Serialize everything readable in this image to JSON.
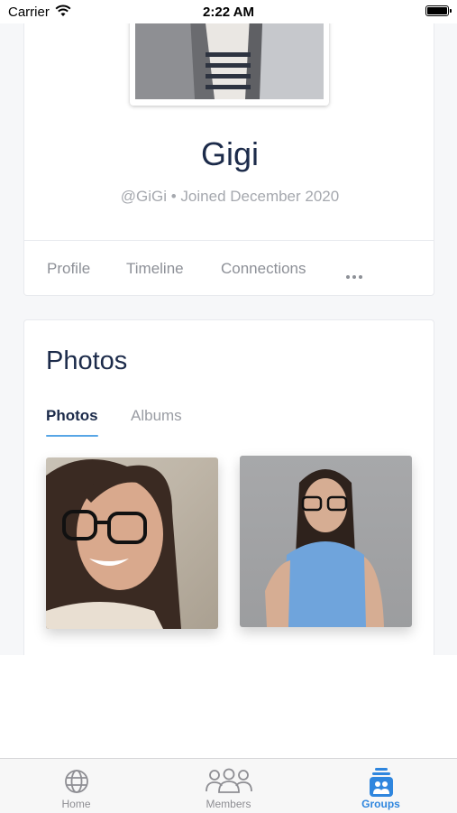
{
  "status_bar": {
    "carrier": "Carrier",
    "time": "2:22 AM"
  },
  "profile": {
    "name": "Gigi",
    "meta": "@GiGi • Joined December 2020",
    "tabs": [
      "Profile",
      "Timeline",
      "Connections"
    ],
    "more_icon": "more-horizontal-icon"
  },
  "photos": {
    "title": "Photos",
    "tabs": [
      {
        "label": "Photos",
        "active": true
      },
      {
        "label": "Albums",
        "active": false
      }
    ],
    "accent": "#58a6e6"
  },
  "tab_bar": {
    "items": [
      {
        "label": "Home",
        "icon": "globe-icon",
        "active": false
      },
      {
        "label": "Members",
        "icon": "members-icon",
        "active": false
      },
      {
        "label": "Groups",
        "icon": "groups-icon",
        "active": true
      }
    ],
    "active_color": "#2f86de",
    "inactive_color": "#8e8e93"
  }
}
